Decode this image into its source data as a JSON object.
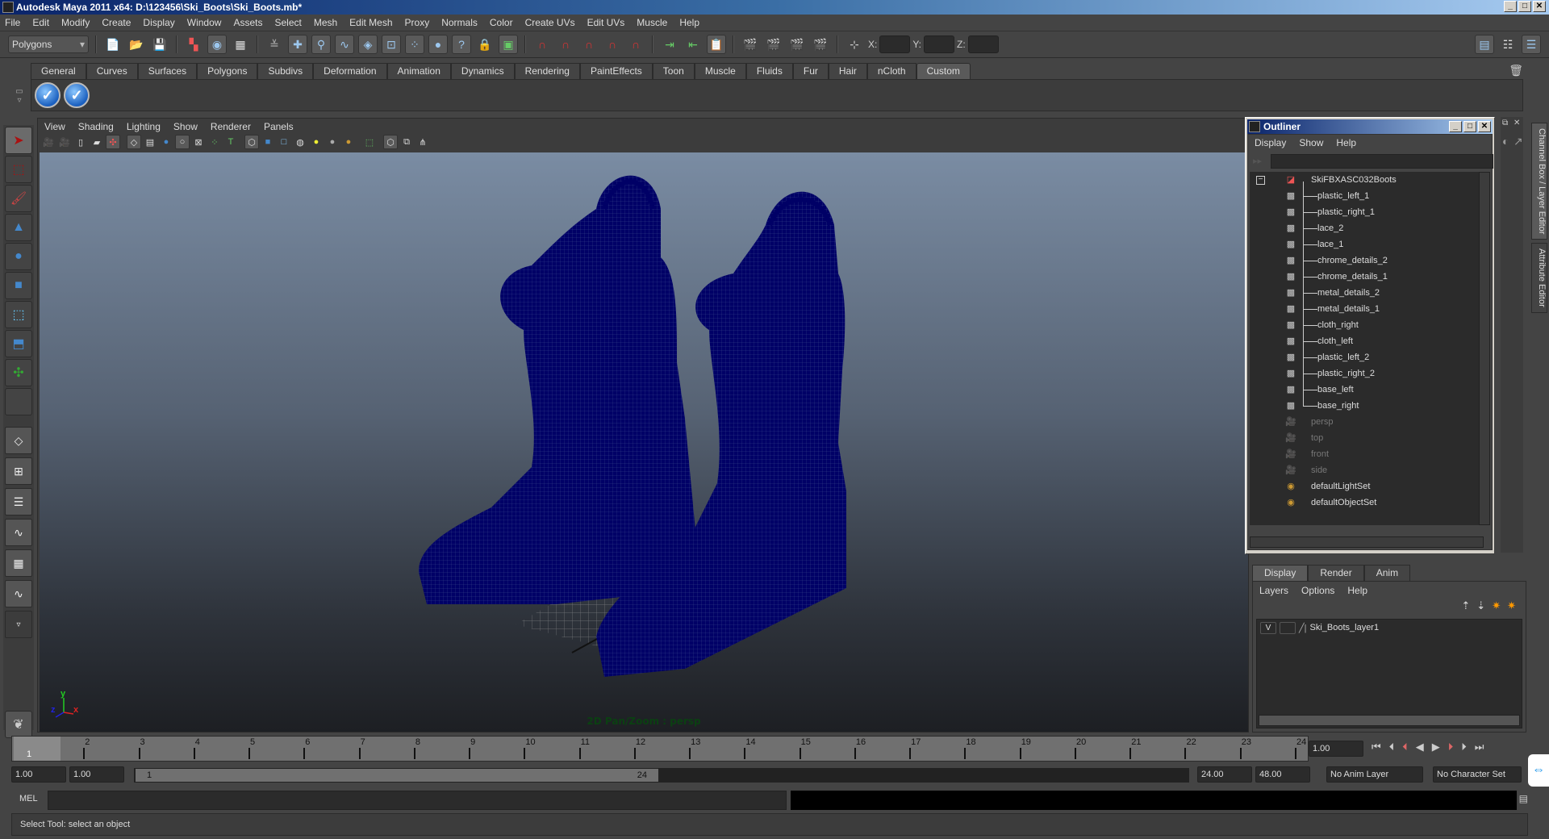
{
  "window": {
    "title": "Autodesk Maya 2011 x64: D:\\123456\\Ski_Boots\\Ski_Boots.mb*",
    "controls": [
      "_",
      "□",
      "✕"
    ]
  },
  "menubar": [
    "File",
    "Edit",
    "Modify",
    "Create",
    "Display",
    "Window",
    "Assets",
    "Select",
    "Mesh",
    "Edit Mesh",
    "Proxy",
    "Normals",
    "Color",
    "Create UVs",
    "Edit UVs",
    "Muscle",
    "Help"
  ],
  "statusline": {
    "mode": "Polygons",
    "x_label": "X:",
    "y_label": "Y:",
    "z_label": "Z:",
    "x_value": "",
    "y_value": "",
    "z_value": ""
  },
  "shelf": {
    "tabs": [
      "General",
      "Curves",
      "Surfaces",
      "Polygons",
      "Subdivs",
      "Deformation",
      "Animation",
      "Dynamics",
      "Rendering",
      "PaintEffects",
      "Toon",
      "Muscle",
      "Fluids",
      "Fur",
      "Hair",
      "nCloth",
      "Custom"
    ],
    "active_tab": "Custom",
    "buttons": [
      "check-icon",
      "check-icon"
    ]
  },
  "viewport": {
    "menu": [
      "View",
      "Shading",
      "Lighting",
      "Show",
      "Renderer",
      "Panels"
    ],
    "hud_text": "2D Pan/Zoom : persp",
    "axis": {
      "x": "x",
      "y": "y",
      "z": "z"
    },
    "wire_color": "#000066"
  },
  "outliner": {
    "title": "Outliner",
    "menu": [
      "Display",
      "Show",
      "Help"
    ],
    "filter_value": "",
    "root": "SkiFBXASC032Boots",
    "children": [
      "plastic_left_1",
      "plastic_right_1",
      "lace_2",
      "lace_1",
      "chrome_details_2",
      "chrome_details_1",
      "metal_details_2",
      "metal_details_1",
      "cloth_right",
      "cloth_left",
      "plastic_left_2",
      "plastic_right_2",
      "base_left",
      "base_right"
    ],
    "cameras": [
      "persp",
      "top",
      "front",
      "side"
    ],
    "sets": [
      "defaultLightSet",
      "defaultObjectSet"
    ]
  },
  "side_tabs": [
    "Channel Box / Layer Editor",
    "Attribute Editor"
  ],
  "layer_editor": {
    "tabs": [
      "Display",
      "Render",
      "Anim"
    ],
    "active_tab": "Display",
    "menu": [
      "Layers",
      "Options",
      "Help"
    ],
    "layers": [
      {
        "visible": "V",
        "name": "Ski_Boots_layer1"
      }
    ]
  },
  "timeline": {
    "ticks": [
      "1",
      "2",
      "3",
      "4",
      "5",
      "6",
      "7",
      "8",
      "9",
      "10",
      "11",
      "12",
      "13",
      "14",
      "15",
      "16",
      "17",
      "18",
      "19",
      "20",
      "21",
      "22",
      "23",
      "24"
    ],
    "current_frame_marker": "1",
    "current_time": "1.00"
  },
  "range": {
    "start_time": "1.00",
    "playback_start": "1.00",
    "slider_start": "1",
    "slider_end": "24",
    "playback_end": "24.00",
    "end_time": "48.00",
    "anim_layer": "No Anim Layer",
    "character_set": "No Character Set"
  },
  "command_line": {
    "label": "MEL",
    "value": "",
    "result": ""
  },
  "status": {
    "help_line": "Select Tool: select an object"
  }
}
